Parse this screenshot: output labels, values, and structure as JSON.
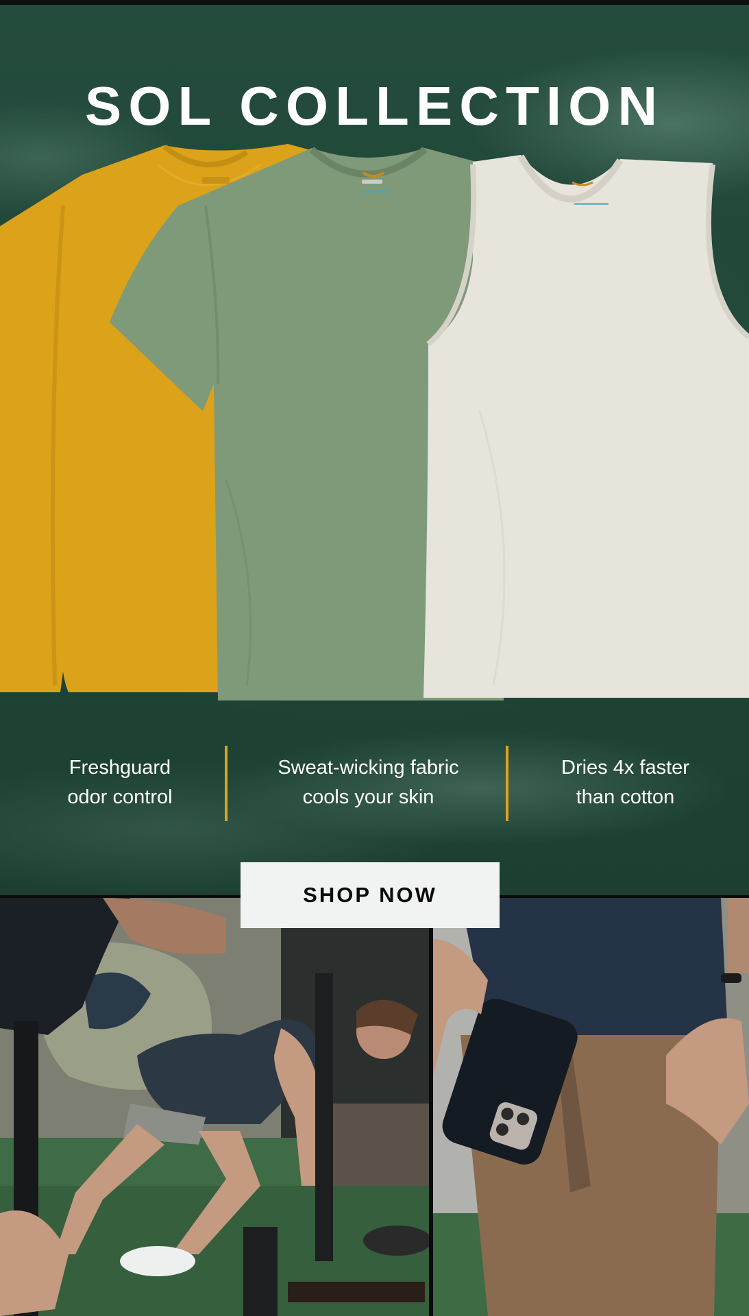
{
  "hero": {
    "title": "SOL COLLECTION"
  },
  "features": [
    {
      "line1": "Freshguard",
      "line2": "odor control"
    },
    {
      "line1": "Sweat-wicking fabric",
      "line2": "cools your skin"
    },
    {
      "line1": "Dries 4x faster",
      "line2": "than cotton"
    }
  ],
  "cta": {
    "label": "SHOP NOW"
  },
  "shirts": [
    {
      "type": "long-sleeve",
      "color": "#dba21a"
    },
    {
      "type": "t-shirt",
      "color": "#7f9a79"
    },
    {
      "type": "tank-top",
      "color": "#e7e4dc"
    }
  ],
  "colors": {
    "background": "#1f4536",
    "divider": "#e0a21e",
    "button_bg": "#f1f2f2",
    "text": "#ffffff"
  },
  "photos": [
    {
      "subject": "athlete-pushing-sled"
    },
    {
      "subject": "phone-into-pocket"
    }
  ]
}
